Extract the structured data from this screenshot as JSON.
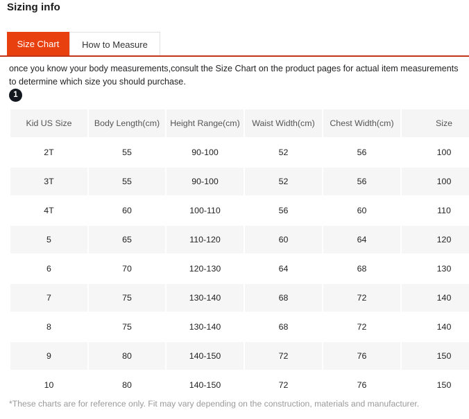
{
  "page": {
    "title": "Sizing info",
    "top_remnant": "",
    "footnote": "*These charts are for reference only. Fit may vary depending on the construction, materials and manufacturer."
  },
  "tabs": {
    "active_color": "#e8400f",
    "rule_color": "#c0341a",
    "items": [
      {
        "label": "Size Chart",
        "active": true
      },
      {
        "label": "How to Measure",
        "active": false
      }
    ]
  },
  "intro": {
    "text": "once you know your body measurements,consult the Size Chart on the product pages for actual item measurements to determine which size you should purchase."
  },
  "badge": {
    "label": "1",
    "color": "#13181f"
  },
  "chart_data": {
    "type": "table",
    "title": "Size Chart",
    "columns": [
      "Kid US Size",
      "Body Length(cm)",
      "Height Range(cm)",
      "Waist Width(cm)",
      "Chest Width(cm)",
      "Size"
    ],
    "rows": [
      [
        "2T",
        "55",
        "90-100",
        "52",
        "56",
        "100"
      ],
      [
        "3T",
        "55",
        "90-100",
        "52",
        "56",
        "100"
      ],
      [
        "4T",
        "60",
        "100-110",
        "56",
        "60",
        "110"
      ],
      [
        "5",
        "65",
        "110-120",
        "60",
        "64",
        "120"
      ],
      [
        "6",
        "70",
        "120-130",
        "64",
        "68",
        "130"
      ],
      [
        "7",
        "75",
        "130-140",
        "68",
        "72",
        "140"
      ],
      [
        "8",
        "75",
        "130-140",
        "68",
        "72",
        "140"
      ],
      [
        "9",
        "80",
        "140-150",
        "72",
        "76",
        "150"
      ],
      [
        "10",
        "80",
        "140-150",
        "72",
        "76",
        "150"
      ]
    ]
  }
}
